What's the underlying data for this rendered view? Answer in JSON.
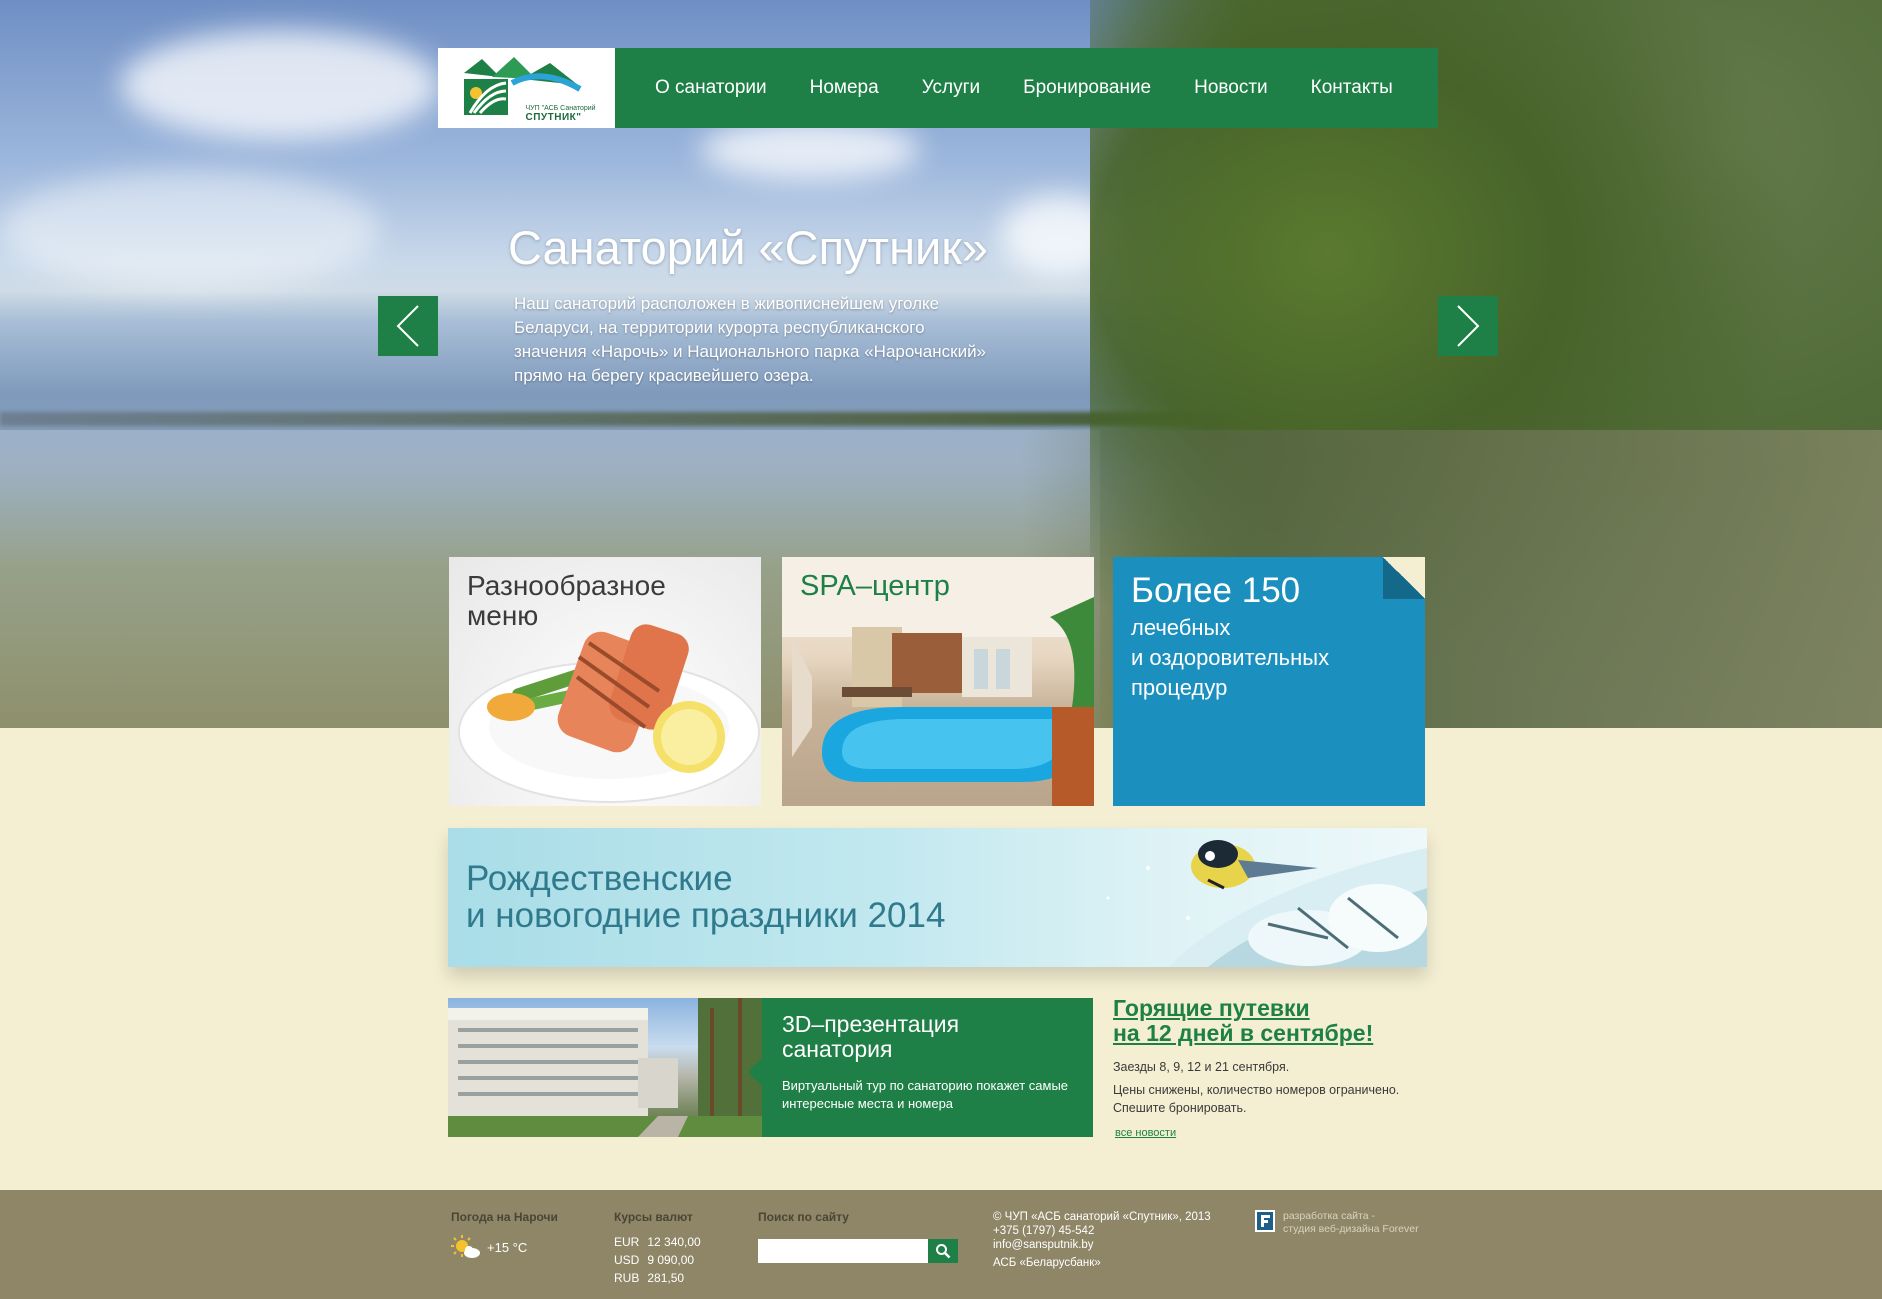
{
  "header": {
    "logo": {
      "subtitle": "ЧУП \"АСБ Санаторий",
      "name": "СПУТНИК\""
    },
    "nav": [
      "О санатории",
      "Номера",
      "Услуги",
      "Бронирование",
      "Новости",
      "Контакты"
    ]
  },
  "hero": {
    "title": "Санаторий «Спутник»",
    "text": "Наш санаторий расположен в живописнейшем уголке Беларуси, на территории курорта республиканского значения «Нарочь» и Национального парка «Нарочанский» прямо на берегу красивейшего озера.",
    "prev_icon": "chevron-left-icon",
    "next_icon": "chevron-right-icon"
  },
  "tiles": {
    "menu": {
      "title_1": "Разнообразное",
      "title_2": "меню"
    },
    "spa": {
      "title": "SPA–центр"
    },
    "procedures": {
      "big": "Более 150",
      "small_1": "лечебных",
      "small_2": "и оздоровительных",
      "small_3": "процедур"
    }
  },
  "banner": {
    "line_1": "Рождественские",
    "line_2": "и новогодние праздники 2014"
  },
  "presentation": {
    "title_1": "3D–презентация",
    "title_2": "санатория",
    "text": "Виртуальный тур по санаторию покажет самые интересные места и номера"
  },
  "news": {
    "title_1": "Горящие путевки",
    "title_2": "на 12 дней в сентябре!",
    "line_1": "Заезды 8, 9, 12 и 21 сентября.",
    "line_2": "Цены снижены, количество номеров ограничено.",
    "line_3": "Спешите бронировать.",
    "all_link": "все новости"
  },
  "footer": {
    "weather": {
      "title": "Погода на Нарочи",
      "temp": "+15 °С",
      "icon": "sun-cloud-icon"
    },
    "rates": {
      "title": "Курсы валют",
      "rows": [
        {
          "code": "EUR",
          "value": "12 340,00"
        },
        {
          "code": "USD",
          "value": "9 090,00"
        },
        {
          "code": "RUB",
          "value": "281,50"
        }
      ]
    },
    "search": {
      "title": "Поиск по сайту",
      "placeholder": "",
      "icon": "search-icon"
    },
    "contact": {
      "copyright": "©  ЧУП «АСБ санаторий «Спутник», 2013",
      "phone": "+375 (1797) 45-542",
      "email": "info@sansputnik.by",
      "bank": "АСБ «Беларусбанк»"
    },
    "developer": {
      "line_1": "разработка сайта -",
      "line_2": "студия веб-дизайна Forever"
    }
  },
  "colors": {
    "brand_green": "#1e8046",
    "accent_blue": "#1b8fbd",
    "footer": "#8f8668",
    "background": "#f4efd3"
  }
}
